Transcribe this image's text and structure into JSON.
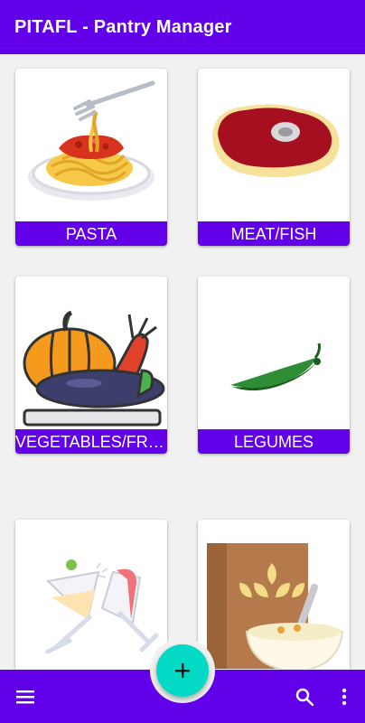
{
  "app_bar": {
    "title": "PITAFL - Pantry Manager",
    "color": "#6200ea"
  },
  "categories": [
    {
      "label": "PASTA",
      "icon": "pasta-plate-icon"
    },
    {
      "label": "MEAT/FISH",
      "icon": "steak-icon"
    },
    {
      "label": "VEGETABLES/FRUIT",
      "icon": "vegetables-icon"
    },
    {
      "label": "LEGUMES",
      "icon": "pea-pod-icon"
    },
    {
      "label": "",
      "icon": "cocktail-glasses-icon"
    },
    {
      "label": "",
      "icon": "cereal-box-icon"
    }
  ],
  "bottom_bar": {
    "menu_icon": "menu-icon",
    "search_icon": "search-icon",
    "more_icon": "more-vert-icon",
    "fab_icon": "plus-icon",
    "fab_color": "#03dac5"
  }
}
